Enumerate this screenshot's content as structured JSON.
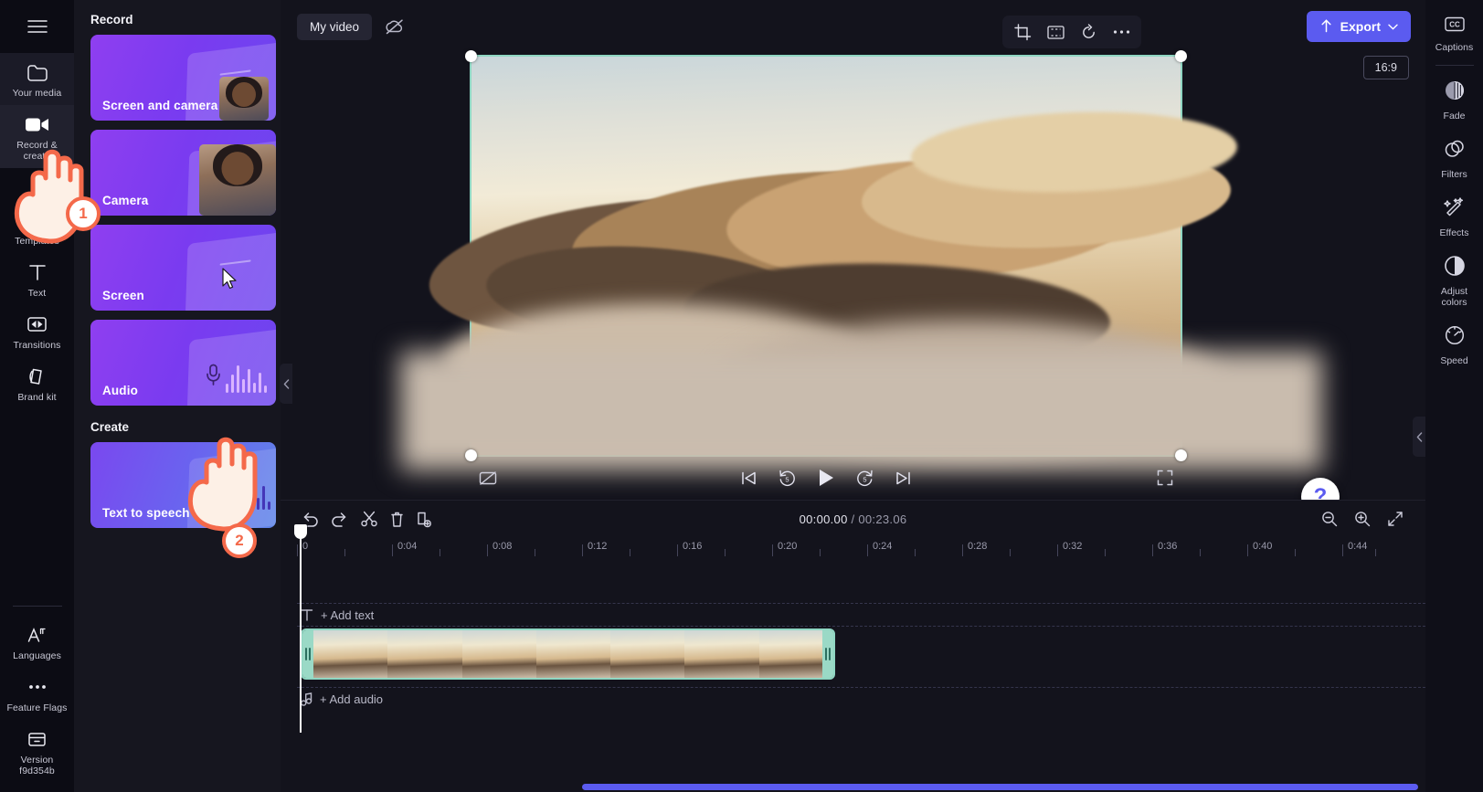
{
  "left_rail": {
    "menu_icon": "hamburger-icon",
    "items": [
      {
        "label": "Your media",
        "icon": "folder-icon",
        "active": true
      },
      {
        "label": "Record & create",
        "icon": "video-camera-icon",
        "active": true
      },
      {
        "label": "Templates",
        "icon": "templates-icon",
        "active": false
      },
      {
        "label": "Text",
        "icon": "text-icon",
        "active": false
      },
      {
        "label": "Transitions",
        "icon": "transitions-icon",
        "active": false
      },
      {
        "label": "Brand kit",
        "icon": "brand-kit-icon",
        "active": false
      }
    ],
    "bottom_items": [
      {
        "label": "Languages",
        "icon": "languages-icon"
      },
      {
        "label": "Feature Flags",
        "icon": "ellipsis-icon"
      },
      {
        "label": "Version f9d354b",
        "icon": "archive-icon"
      }
    ]
  },
  "panel": {
    "record_title": "Record",
    "create_title": "Create",
    "record_cards": [
      {
        "label": "Screen and camera",
        "art": "screen-and-camera"
      },
      {
        "label": "Camera",
        "art": "camera"
      },
      {
        "label": "Screen",
        "art": "screen"
      },
      {
        "label": "Audio",
        "art": "audio"
      }
    ],
    "create_cards": [
      {
        "label": "Text to speech",
        "art": "text-to-speech"
      }
    ],
    "collapse_icon": "chevron-left-icon"
  },
  "topbar": {
    "project_name": "My video",
    "cloud_icon": "cloud-off-icon",
    "tools": [
      {
        "name": "crop-icon"
      },
      {
        "name": "fit-frame-icon"
      },
      {
        "name": "rotate-icon"
      },
      {
        "name": "more-options-icon"
      }
    ],
    "export_label": "Export",
    "export_icon": "upload-icon",
    "export_chevron": "chevron-down-icon",
    "export_color": "#5b5bf0"
  },
  "preview": {
    "aspect_ratio": "16:9",
    "selection_color": "#8fd6c2",
    "controls": {
      "captions_off": "captions-off-icon",
      "skip_start": "skip-to-start-icon",
      "back_5": "rewind-5s-icon",
      "play": "play-icon",
      "forward_5": "forward-5s-icon",
      "skip_end": "skip-to-end-icon",
      "fullscreen": "fullscreen-icon"
    },
    "collapse_icon": "chevron-left-icon",
    "help_label": "?"
  },
  "timeline": {
    "toolbar": [
      {
        "name": "undo-icon"
      },
      {
        "name": "redo-icon"
      },
      {
        "name": "split-icon"
      },
      {
        "name": "delete-icon"
      },
      {
        "name": "duplicate-icon"
      }
    ],
    "current_time": "00:00.00",
    "separator": " / ",
    "total_time": "00:23.06",
    "zoom_out_icon": "zoom-out-icon",
    "zoom_in_icon": "zoom-in-icon",
    "fit_icon": "fit-timeline-icon",
    "collapse_icon": "chevron-down-icon",
    "ruler_labels": [
      "0",
      "0:04",
      "0:08",
      "0:12",
      "0:16",
      "0:20",
      "0:24",
      "0:28",
      "0:32",
      "0:36",
      "0:40",
      "0:44"
    ],
    "add_text_label": "+ Add text",
    "add_text_icon": "text-icon",
    "add_audio_label": "+ Add audio",
    "add_audio_icon": "music-note-icon",
    "clip_thumbnails": 7
  },
  "right_rail": {
    "items": [
      {
        "label": "Captions",
        "icon": "cc-icon"
      },
      {
        "label": "Fade",
        "icon": "fade-icon"
      },
      {
        "label": "Filters",
        "icon": "filters-icon"
      },
      {
        "label": "Effects",
        "icon": "effects-icon"
      },
      {
        "label": "Adjust colors",
        "icon": "adjust-colors-icon"
      },
      {
        "label": "Speed",
        "icon": "speed-icon"
      }
    ]
  },
  "annotations": {
    "badge_1": "1",
    "badge_2": "2",
    "accent": "#f4694a"
  }
}
